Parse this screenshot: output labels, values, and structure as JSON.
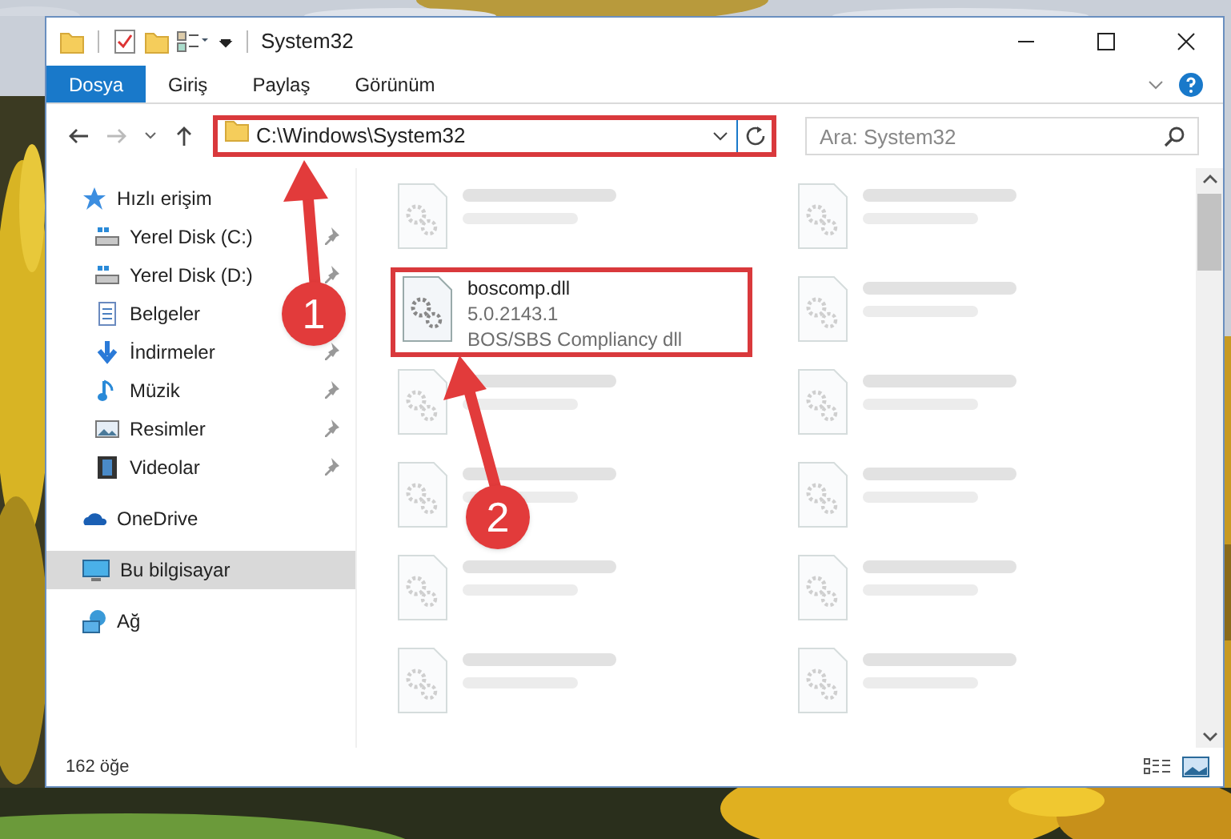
{
  "window": {
    "title": "System32"
  },
  "ribbon_tabs": [
    {
      "label": "Dosya",
      "selected": true
    },
    {
      "label": "Giriş",
      "selected": false
    },
    {
      "label": "Paylaş",
      "selected": false
    },
    {
      "label": "Görünüm",
      "selected": false
    }
  ],
  "address": {
    "path": "C:\\Windows\\System32",
    "highlighted": true
  },
  "search": {
    "placeholder": "Ara: System32"
  },
  "sidebar": {
    "items": [
      {
        "label": "Hızlı erişim",
        "kind": "star",
        "selected": false,
        "children": [
          {
            "label": "Yerel Disk (C:)",
            "kind": "drive",
            "pinned": true,
            "selected": false
          },
          {
            "label": "Yerel Disk (D:)",
            "kind": "drive",
            "pinned": true,
            "selected": false
          },
          {
            "label": "Belgeler",
            "kind": "document",
            "selected": false
          },
          {
            "label": "İndirmeler",
            "kind": "download",
            "pinned": true,
            "selected": false
          },
          {
            "label": "Müzik",
            "kind": "music",
            "pinned": true,
            "selected": false
          },
          {
            "label": "Resimler",
            "kind": "pictures",
            "pinned": true,
            "selected": false
          },
          {
            "label": "Videolar",
            "kind": "video",
            "pinned": true,
            "selected": false
          }
        ]
      },
      {
        "label": "OneDrive",
        "kind": "cloud",
        "selected": false
      },
      {
        "label": "Bu bilgisayar",
        "kind": "computer",
        "selected": true
      },
      {
        "label": "Ağ",
        "kind": "network",
        "selected": false
      }
    ]
  },
  "files": [
    {
      "kind": "blurred"
    },
    {
      "kind": "blurred"
    },
    {
      "kind": "file",
      "name": "boscomp.dll",
      "lines": [
        "5.0.2143.1",
        "BOS/SBS Compliancy dll"
      ],
      "highlighted": true
    },
    {
      "kind": "blurred"
    },
    {
      "kind": "blurred"
    },
    {
      "kind": "blurred"
    },
    {
      "kind": "blurred"
    },
    {
      "kind": "blurred"
    },
    {
      "kind": "blurred"
    },
    {
      "kind": "blurred"
    },
    {
      "kind": "blurred"
    },
    {
      "kind": "blurred"
    }
  ],
  "status_bar": {
    "item_count": "162 öğe"
  },
  "callouts": [
    {
      "number": "1"
    },
    {
      "number": "2"
    }
  ]
}
